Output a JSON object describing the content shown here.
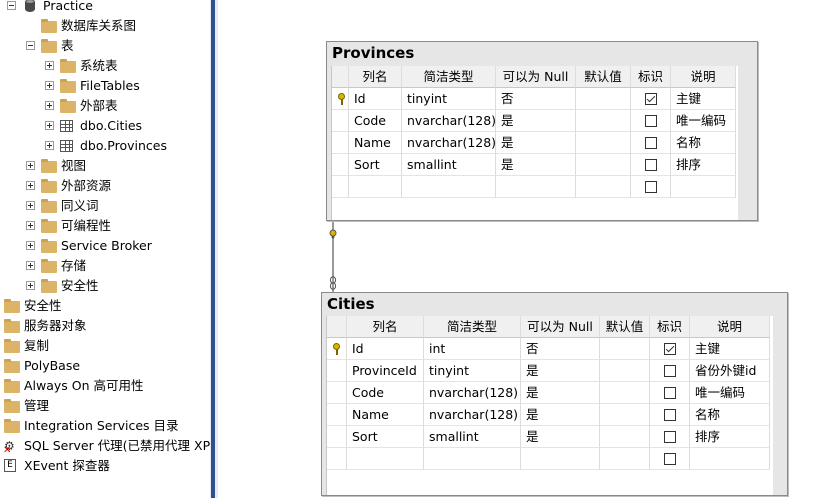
{
  "explorer": {
    "items": [
      {
        "label": "Practice",
        "icon": "database-icon",
        "expander": "minus"
      },
      {
        "label": "数据库关系图",
        "icon": "folder-icon",
        "expander": ""
      },
      {
        "label": "表",
        "icon": "folder-icon",
        "expander": "minus"
      },
      {
        "label": "系统表",
        "icon": "folder-icon",
        "expander": "plus"
      },
      {
        "label": "FileTables",
        "icon": "folder-icon",
        "expander": "plus"
      },
      {
        "label": "外部表",
        "icon": "folder-icon",
        "expander": "plus"
      },
      {
        "label": "dbo.Cities",
        "icon": "table-icon",
        "expander": "plus"
      },
      {
        "label": "dbo.Provinces",
        "icon": "table-icon",
        "expander": "plus"
      },
      {
        "label": "视图",
        "icon": "folder-icon",
        "expander": "plus"
      },
      {
        "label": "外部资源",
        "icon": "folder-icon",
        "expander": "plus"
      },
      {
        "label": "同义词",
        "icon": "folder-icon",
        "expander": "plus"
      },
      {
        "label": "可编程性",
        "icon": "folder-icon",
        "expander": "plus"
      },
      {
        "label": "Service Broker",
        "icon": "folder-icon",
        "expander": "plus"
      },
      {
        "label": "存储",
        "icon": "folder-icon",
        "expander": "plus"
      },
      {
        "label": "安全性",
        "icon": "folder-icon",
        "expander": "plus"
      },
      {
        "label": "安全性",
        "icon": "folder-icon",
        "expander": ""
      },
      {
        "label": "服务器对象",
        "icon": "folder-icon",
        "expander": ""
      },
      {
        "label": "复制",
        "icon": "folder-icon",
        "expander": ""
      },
      {
        "label": "PolyBase",
        "icon": "folder-icon",
        "expander": ""
      },
      {
        "label": "Always On 高可用性",
        "icon": "folder-icon",
        "expander": ""
      },
      {
        "label": "管理",
        "icon": "folder-icon",
        "expander": ""
      },
      {
        "label": "Integration Services 目录",
        "icon": "folder-icon",
        "expander": ""
      },
      {
        "label": "SQL Server 代理(已禁用代理 XP)",
        "icon": "sql-agent-disabled-icon",
        "expander": ""
      },
      {
        "label": "XEvent 探查器",
        "icon": "xevent-profiler-icon",
        "expander": ""
      }
    ]
  },
  "diagram": {
    "columns_header": [
      "列名",
      "简洁类型",
      "可以为 Null",
      "默认值",
      "标识",
      "说明"
    ],
    "provinces": {
      "title": "Provinces",
      "rows": [
        {
          "name": "Id",
          "type": "tinyint",
          "nullable": "否",
          "default": "",
          "identity": true,
          "desc": "主键",
          "pk": true
        },
        {
          "name": "Code",
          "type": "nvarchar(128)",
          "nullable": "是",
          "default": "",
          "identity": false,
          "desc": "唯一编码",
          "pk": false
        },
        {
          "name": "Name",
          "type": "nvarchar(128)",
          "nullable": "是",
          "default": "",
          "identity": false,
          "desc": "名称",
          "pk": false
        },
        {
          "name": "Sort",
          "type": "smallint",
          "nullable": "是",
          "default": "",
          "identity": false,
          "desc": "排序",
          "pk": false
        },
        {
          "name": "",
          "type": "",
          "nullable": "",
          "default": "",
          "identity": false,
          "desc": "",
          "pk": false
        }
      ]
    },
    "cities": {
      "title": "Cities",
      "rows": [
        {
          "name": "Id",
          "type": "int",
          "nullable": "否",
          "default": "",
          "identity": true,
          "desc": "主键",
          "pk": true
        },
        {
          "name": "ProvinceId",
          "type": "tinyint",
          "nullable": "是",
          "default": "",
          "identity": false,
          "desc": "省份外键id",
          "pk": false
        },
        {
          "name": "Code",
          "type": "nvarchar(128)",
          "nullable": "是",
          "default": "",
          "identity": false,
          "desc": "唯一编码",
          "pk": false
        },
        {
          "name": "Name",
          "type": "nvarchar(128)",
          "nullable": "是",
          "default": "",
          "identity": false,
          "desc": "名称",
          "pk": false
        },
        {
          "name": "Sort",
          "type": "smallint",
          "nullable": "是",
          "default": "",
          "identity": false,
          "desc": "排序",
          "pk": false
        },
        {
          "name": "",
          "type": "",
          "nullable": "",
          "default": "",
          "identity": false,
          "desc": "",
          "pk": false
        }
      ]
    }
  },
  "colors": {
    "folder": "#dcb467",
    "splitter": "#2f4f8f",
    "key": "#d8b600",
    "relationship": "#d8b600"
  }
}
